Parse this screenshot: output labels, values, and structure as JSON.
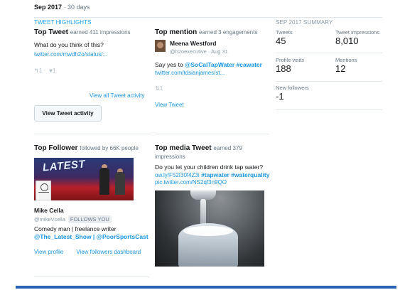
{
  "period": {
    "label": "Sep 2017",
    "sep": " · ",
    "days": "30 days"
  },
  "highlights": {
    "title": "TWEET HIGHLIGHTS"
  },
  "top_tweet": {
    "title": "Top Tweet",
    "subtitle": "earned 411 impressions",
    "text": "What do you think of this?",
    "url": "twitter.com/mwdh2o/status/...",
    "replies": "↰1",
    "likes": "♥1",
    "view_all": "View all Tweet activity",
    "button": "View Tweet activity"
  },
  "top_mention": {
    "title": "Top mention",
    "subtitle": "earned 3 engagements",
    "name": "Meena Westford",
    "handle": "@h2oexecutive · Aug 31",
    "text_prefix": "Say yes to ",
    "hashtags": "@SoCalTapWater #cawater",
    "url": "twitter.com/tdsianjames/st...",
    "retweets": "⇅1",
    "view": "View Tweet"
  },
  "summary": {
    "title": "SEP 2017 SUMMARY",
    "tweets_label": "Tweets",
    "tweets_value": "45",
    "impressions_label": "Tweet impressions",
    "impressions_value": "8,010",
    "profile_label": "Profile visits",
    "profile_value": "188",
    "mentions_label": "Mentions",
    "mentions_value": "12",
    "followers_label": "New followers",
    "followers_value": "-1"
  },
  "top_follower": {
    "title": "Top Follower",
    "subtitle": "followed by 66K people",
    "banner_text": "LATEST",
    "name": "Mike Cella",
    "handle": "@mikeVcella",
    "badge": "FOLLOWS YOU",
    "bio": "Comedy man | freelance writer",
    "bio_handles": "@The_Latest_Show | @PoorSportsCast",
    "view_profile": "View profile",
    "view_dashboard": "View followers dashboard"
  },
  "top_media": {
    "title": "Top media Tweet",
    "subtitle": "earned 379",
    "impressions": "impressions",
    "text": "Do you let your children drink tap water?",
    "link_text": "ow.ly/F52I30f4Z3i",
    "hashtags": "#tapwater #waterquality",
    "pic_url": "pic.twitter.com/NS2qf3n9QO"
  }
}
